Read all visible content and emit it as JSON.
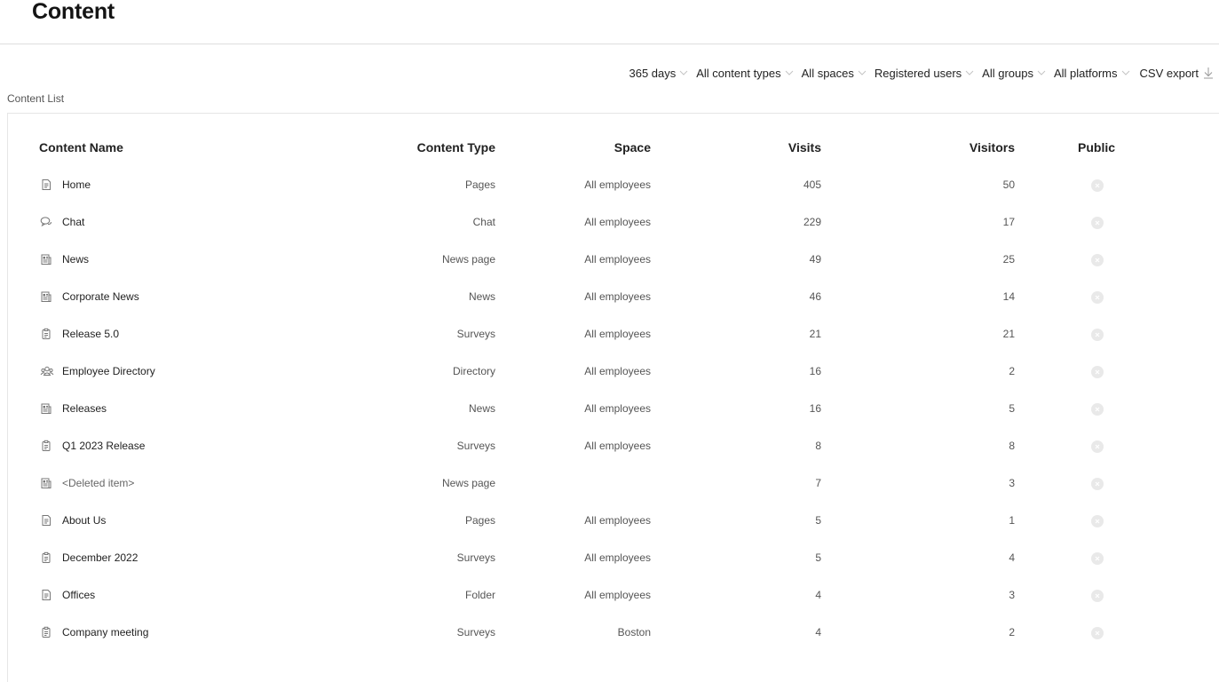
{
  "page": {
    "title": "Content"
  },
  "filters": [
    {
      "label": "365 days"
    },
    {
      "label": "All content types"
    },
    {
      "label": "All spaces"
    },
    {
      "label": "Registered users"
    },
    {
      "label": "All groups"
    },
    {
      "label": "All platforms"
    }
  ],
  "export": {
    "label": "CSV export"
  },
  "section": {
    "label": "Content List"
  },
  "table": {
    "columns": {
      "name": "Content Name",
      "type": "Content Type",
      "space": "Space",
      "visits": "Visits",
      "visitors": "Visitors",
      "public": "Public"
    },
    "rows": [
      {
        "icon": "page-icon",
        "name": "Home",
        "type": "Pages",
        "space": "All employees",
        "visits": "405",
        "visitors": "50",
        "public": "no"
      },
      {
        "icon": "chat-icon",
        "name": "Chat",
        "type": "Chat",
        "space": "All employees",
        "visits": "229",
        "visitors": "17",
        "public": "no"
      },
      {
        "icon": "news-icon",
        "name": "News",
        "type": "News page",
        "space": "All employees",
        "visits": "49",
        "visitors": "25",
        "public": "no"
      },
      {
        "icon": "news-icon",
        "name": "Corporate News",
        "type": "News",
        "space": "All employees",
        "visits": "46",
        "visitors": "14",
        "public": "no"
      },
      {
        "icon": "survey-icon",
        "name": "Release 5.0",
        "type": "Surveys",
        "space": "All employees",
        "visits": "21",
        "visitors": "21",
        "public": "no"
      },
      {
        "icon": "directory-icon",
        "name": "Employee Directory",
        "type": "Directory",
        "space": "All employees",
        "visits": "16",
        "visitors": "2",
        "public": "no"
      },
      {
        "icon": "news-icon",
        "name": "Releases",
        "type": "News",
        "space": "All employees",
        "visits": "16",
        "visitors": "5",
        "public": "no"
      },
      {
        "icon": "survey-icon",
        "name": "Q1 2023 Release",
        "type": "Surveys",
        "space": "All employees",
        "visits": "8",
        "visitors": "8",
        "public": "no"
      },
      {
        "icon": "news-icon",
        "name": "<Deleted item>",
        "type": "News page",
        "space": "",
        "visits": "7",
        "visitors": "3",
        "public": "no"
      },
      {
        "icon": "page-icon",
        "name": "About Us",
        "type": "Pages",
        "space": "All employees",
        "visits": "5",
        "visitors": "1",
        "public": "no"
      },
      {
        "icon": "survey-icon",
        "name": "December 2022",
        "type": "Surveys",
        "space": "All employees",
        "visits": "5",
        "visitors": "4",
        "public": "no"
      },
      {
        "icon": "page-icon",
        "name": "Offices",
        "type": "Folder",
        "space": "All employees",
        "visits": "4",
        "visitors": "3",
        "public": "no"
      },
      {
        "icon": "survey-icon",
        "name": "Company meeting",
        "type": "Surveys",
        "space": "Boston",
        "visits": "4",
        "visitors": "2",
        "public": "no"
      }
    ]
  }
}
